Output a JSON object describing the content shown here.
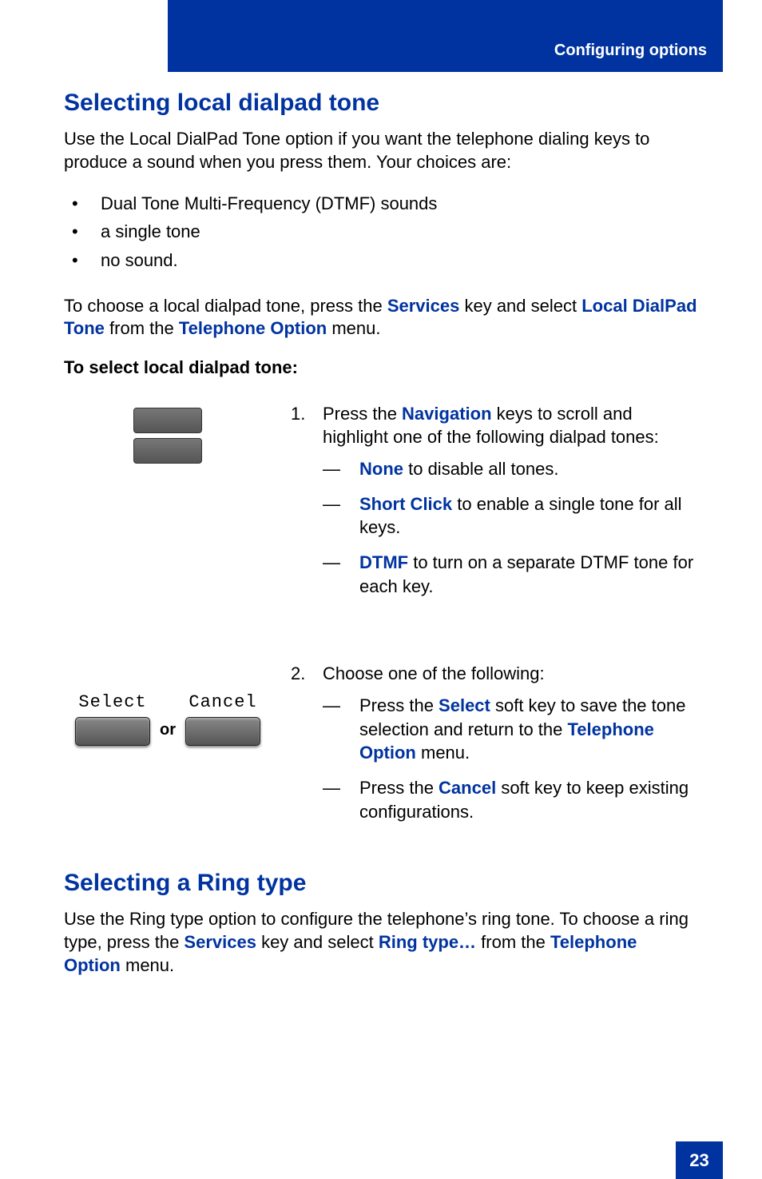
{
  "header": {
    "label": "Configuring options"
  },
  "footer": {
    "page": "23"
  },
  "s1": {
    "title": "Selecting local dialpad tone",
    "intro": "Use the Local DialPad Tone option if you want the telephone dialing keys to produce a sound when you press them. Your choices are:",
    "choices": [
      "Dual Tone Multi-Frequency (DTMF) sounds",
      "a single tone",
      "no sound."
    ],
    "to_choose_pre": "To choose a local dialpad tone, press the ",
    "services": "Services",
    "to_choose_mid": " key and select ",
    "local_dialpad_tone": "Local DialPad Tone",
    "to_choose_mid2": " from the ",
    "telephone_option": "Telephone Option",
    "to_choose_end": " menu.",
    "task_label": "To select local dialpad tone:",
    "step1": {
      "num": "1.",
      "pre": "Press the ",
      "nav": "Navigation",
      "post": " keys to scroll and highlight one of the following dialpad tones:",
      "opt_none_k": "None",
      "opt_none_t": " to disable all tones.",
      "opt_short_k": "Short Click",
      "opt_short_t": " to enable a single tone for all keys.",
      "opt_dtmf_k": "DTMF",
      "opt_dtmf_t": " to turn on a separate DTMF tone for each key."
    },
    "step2": {
      "num": "2.",
      "lead": "Choose one of the following:",
      "a_pre": "Press the ",
      "a_k": "Select",
      "a_mid": " soft key to save the tone selection and return to the ",
      "a_menu": "Telephone Option",
      "a_end": " menu.",
      "b_pre": "Press the ",
      "b_k": "Cancel",
      "b_end": " soft key to keep existing configurations."
    },
    "softkeys": {
      "select": "Select",
      "cancel": "Cancel",
      "or": "or"
    }
  },
  "s2": {
    "title": "Selecting a Ring type",
    "p_pre": "Use the Ring type option to configure the telephone’s ring tone. To choose a ring type, press the ",
    "services": "Services",
    "p_mid": " key and select ",
    "ring_type": "Ring type…",
    "p_mid2": " from the ",
    "telephone_option": "Telephone Option",
    "p_end": " menu."
  }
}
